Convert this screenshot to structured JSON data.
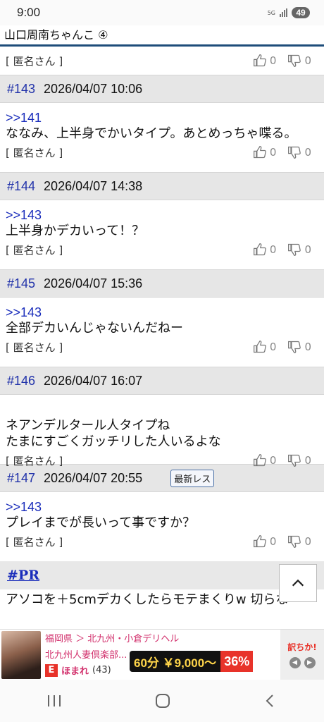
{
  "status": {
    "time": "9:00",
    "network": "5G",
    "battery": "49"
  },
  "thread": {
    "title": "山口周南ちゃんこ ④"
  },
  "top_post": {
    "author": "[ 匿名さん ]",
    "likes": "0",
    "dislikes": "0"
  },
  "posts": [
    {
      "num": "#143",
      "date": "2026/04/07 10:06",
      "anchor": ">>141",
      "lines": [
        "ななみ、上半身でかいタイプ。あとめっちゃ喋る。"
      ],
      "author": "[ 匿名さん ]",
      "likes": "0",
      "dislikes": "0"
    },
    {
      "num": "#144",
      "date": "2026/04/07 14:38",
      "anchor": ">>143",
      "lines": [
        "上半身かデカいって！？"
      ],
      "author": "[ 匿名さん ]",
      "likes": "0",
      "dislikes": "0"
    },
    {
      "num": "#145",
      "date": "2026/04/07 15:36",
      "anchor": ">>143",
      "lines": [
        "全部デカいんじゃないんだねー"
      ],
      "author": "[ 匿名さん ]",
      "likes": "0",
      "dislikes": "0"
    },
    {
      "num": "#146",
      "date": "2026/04/07 16:07",
      "anchor": "",
      "lines": [
        "ネアンデルタール人タイプね",
        "たまにすごくガッチリした人いるよな"
      ],
      "author": "[ 匿名さん ]",
      "likes": "0",
      "dislikes": "0"
    },
    {
      "num": "#147",
      "date": "2026/04/07 20:55",
      "badge": "最新レス",
      "anchor": ">>143",
      "lines": [
        "プレイまでが長いって事ですか？"
      ],
      "author": "[ 匿名さん ]",
      "likes": "0",
      "dislikes": "0"
    }
  ],
  "pr": {
    "label": "#PR",
    "text": "アソコを＋5cmデカくしたらモテまくりw 切らな"
  },
  "ad": {
    "line1": "福岡県 ＞ 北九州・小倉デリヘル",
    "line2": "北九州人妻倶楽部...",
    "e_mark": "E",
    "brand": "ほまれ",
    "count": "(43)",
    "price": "60分 ￥9,000〜",
    "discount": "36%",
    "logo": "訳ちか!"
  },
  "colors": {
    "link": "#1a2dbb",
    "header_bg": "#e6e6e6",
    "title_rule": "#1e4d7a"
  }
}
